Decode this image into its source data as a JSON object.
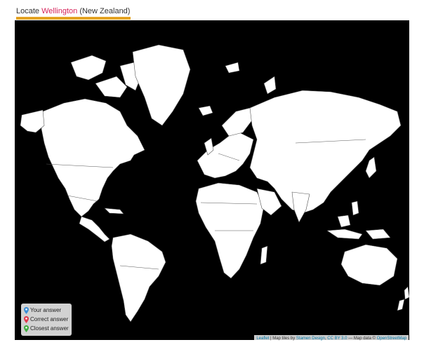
{
  "prompt": {
    "prefix": "Locate ",
    "city": "Wellington",
    "suffix": " (New Zealand)"
  },
  "legend": {
    "items": [
      {
        "label": "Your answer",
        "icon": "map-pin-icon",
        "color": "#3b8ed6"
      },
      {
        "label": "Correct answer",
        "icon": "map-pin-icon",
        "color": "#e03a4d"
      },
      {
        "label": "Closest answer",
        "icon": "map-pin-icon",
        "color": "#3fae3f"
      }
    ]
  },
  "attribution": {
    "leaflet": "Leaflet",
    "sep1": " | Map tiles by ",
    "stamen": "Stamen Design",
    "comma": ", ",
    "license": "CC BY 3.0",
    "sep2": " — Map data © ",
    "osm": "OpenStreetMap"
  },
  "colors": {
    "ocean": "#000000",
    "land": "#ffffff",
    "border": "#555555",
    "underline": "#e5a323",
    "city": "#d6245b"
  }
}
